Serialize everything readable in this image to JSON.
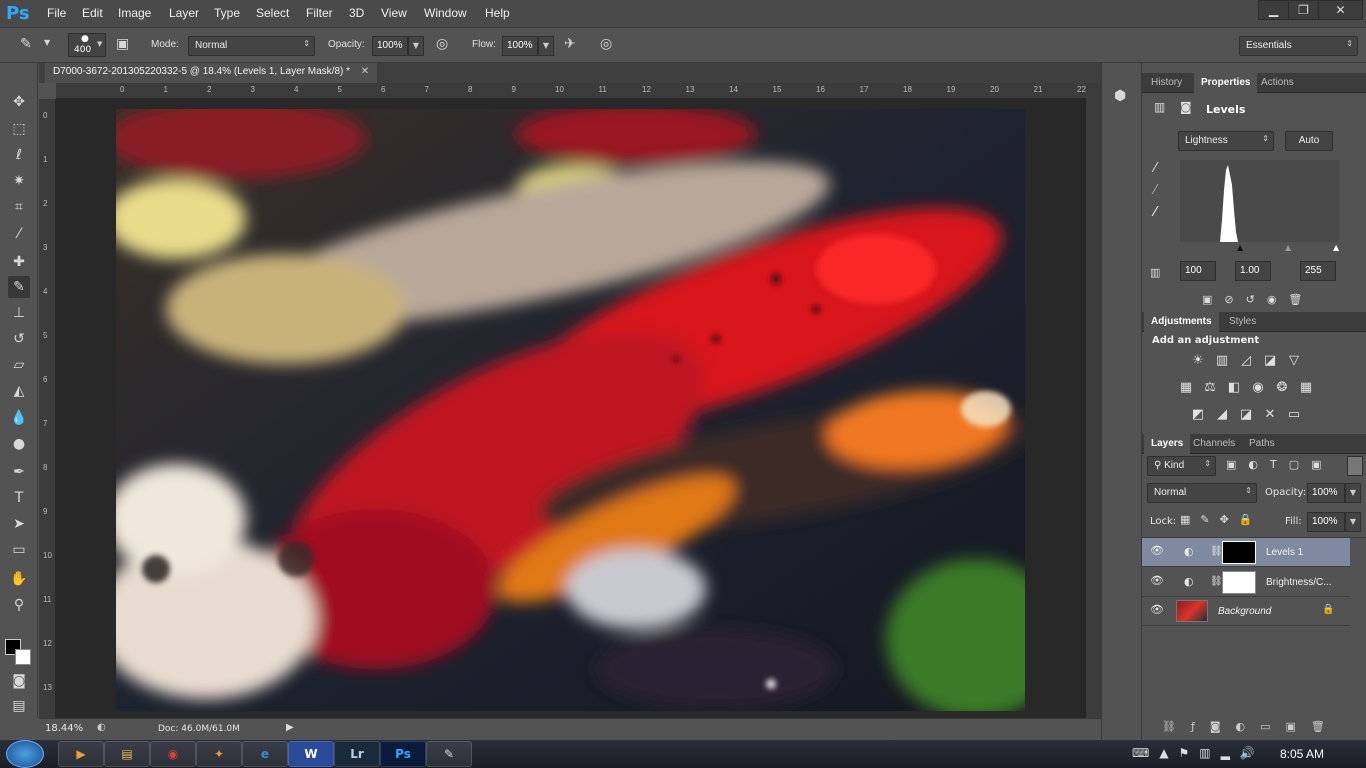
{
  "app": {
    "logo": "Ps"
  },
  "menu": [
    "File",
    "Edit",
    "Image",
    "Layer",
    "Type",
    "Select",
    "Filter",
    "3D",
    "View",
    "Window",
    "Help"
  ],
  "window_controls": {
    "minimize": "▁",
    "restore": "❐",
    "close": "✕"
  },
  "options": {
    "brush_size": "400",
    "mode_label": "Mode:",
    "mode_value": "Normal",
    "opacity_label": "Opacity:",
    "opacity_value": "100%",
    "flow_label": "Flow:",
    "flow_value": "100%",
    "workspace": "Essentials"
  },
  "document": {
    "tab_title": "D7000-3672-201305220332-5 @ 18.4% (Levels 1, Layer Mask/8) *",
    "tab_close": "✕",
    "zoom": "18.44%",
    "doc_size": "Doc: 46.0M/61.0M"
  },
  "rulers": {
    "top": [
      "0",
      "1",
      "2",
      "3",
      "4",
      "5",
      "6",
      "7",
      "8",
      "9",
      "10",
      "11",
      "12",
      "13",
      "14",
      "15",
      "16",
      "17",
      "18",
      "19",
      "20",
      "21",
      "22",
      "23"
    ],
    "left": [
      "0",
      "1",
      "2",
      "3",
      "4",
      "5",
      "6",
      "7",
      "8",
      "9",
      "10",
      "11",
      "12",
      "13"
    ]
  },
  "properties_panel": {
    "tabs": [
      "History",
      "Properties",
      "Actions"
    ],
    "active_tab": "Properties",
    "title": "Levels",
    "preset": "Lightness",
    "auto_label": "Auto",
    "inputs": [
      "100",
      "1.00",
      "255"
    ]
  },
  "adjustments_panel": {
    "tabs": [
      "Adjustments",
      "Styles"
    ],
    "heading": "Add an adjustment"
  },
  "layers_panel": {
    "tabs": [
      "Layers",
      "Channels",
      "Paths"
    ],
    "kind_label": "Kind",
    "blend_mode": "Normal",
    "opacity_label": "Opacity:",
    "opacity_value": "100%",
    "lock_label": "Lock:",
    "fill_label": "Fill:",
    "fill_value": "100%",
    "layers": [
      {
        "name": "Levels 1",
        "selected": true
      },
      {
        "name": "Brightness/C...",
        "selected": false
      },
      {
        "name": "Background",
        "selected": false
      }
    ]
  },
  "taskbar": {
    "apps": [
      "W",
      "Lr",
      "Ps"
    ],
    "time": "8:05 AM"
  },
  "colors": {
    "accent": "#31a8ff",
    "selected_layer": "#7f8aa0"
  }
}
